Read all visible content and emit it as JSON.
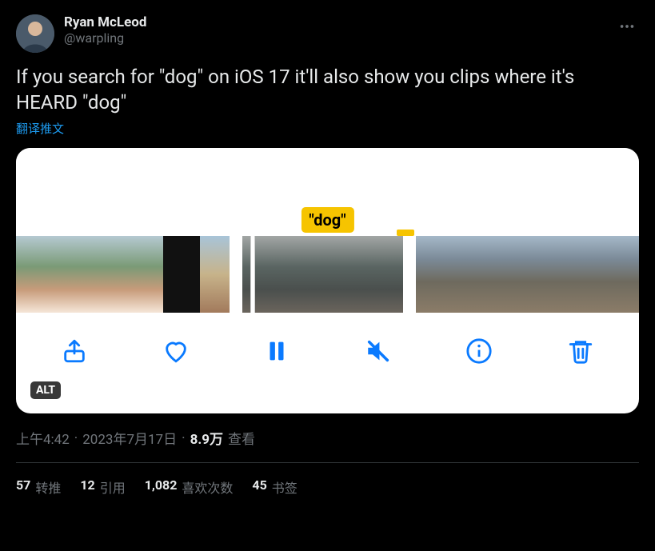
{
  "author": {
    "display_name": "Ryan McLeod",
    "handle": "@warpling"
  },
  "text": "If you search for \"dog\" on iOS 17 it'll also show you clips where it's HEARD \"dog\"",
  "translate_label": "翻译推文",
  "media": {
    "caption_label": "\"dog\"",
    "alt_badge": "ALT"
  },
  "meta": {
    "time": "上午4:42",
    "date": "2023年7月17日",
    "separator": "·",
    "views_count": "8.9万",
    "views_label": "查看"
  },
  "stats": {
    "retweets": {
      "count": "57",
      "label": "转推"
    },
    "quotes": {
      "count": "12",
      "label": "引用"
    },
    "likes": {
      "count": "1,082",
      "label": "喜欢次数"
    },
    "bookmarks": {
      "count": "45",
      "label": "书签"
    }
  }
}
